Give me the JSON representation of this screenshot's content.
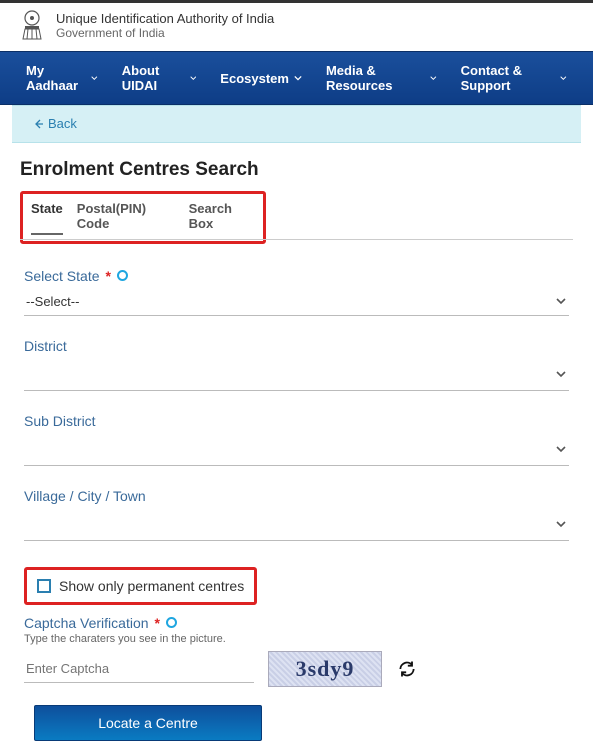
{
  "header": {
    "org_name": "Unique Identification Authority of India",
    "gov_line": "Government of India"
  },
  "nav": {
    "items": [
      "My Aadhaar",
      "About UIDAI",
      "Ecosystem",
      "Media & Resources",
      "Contact & Support"
    ]
  },
  "back_label": "Back",
  "page_title": "Enrolment Centres Search",
  "tabs": [
    "State",
    "Postal(PIN) Code",
    "Search Box"
  ],
  "form": {
    "state": {
      "label": "Select State",
      "value": "--Select--"
    },
    "district": {
      "label": "District",
      "value": ""
    },
    "subdistrict": {
      "label": "Sub District",
      "value": ""
    },
    "vct": {
      "label": "Village / City / Town",
      "value": ""
    },
    "permanent_only": {
      "label": "Show only permanent centres",
      "checked": false
    },
    "captcha": {
      "label": "Captcha Verification",
      "hint": "Type the charaters you see in the picture.",
      "placeholder": "Enter Captcha",
      "image_text": "3sdy9"
    },
    "submit_label": "Locate a Centre"
  }
}
